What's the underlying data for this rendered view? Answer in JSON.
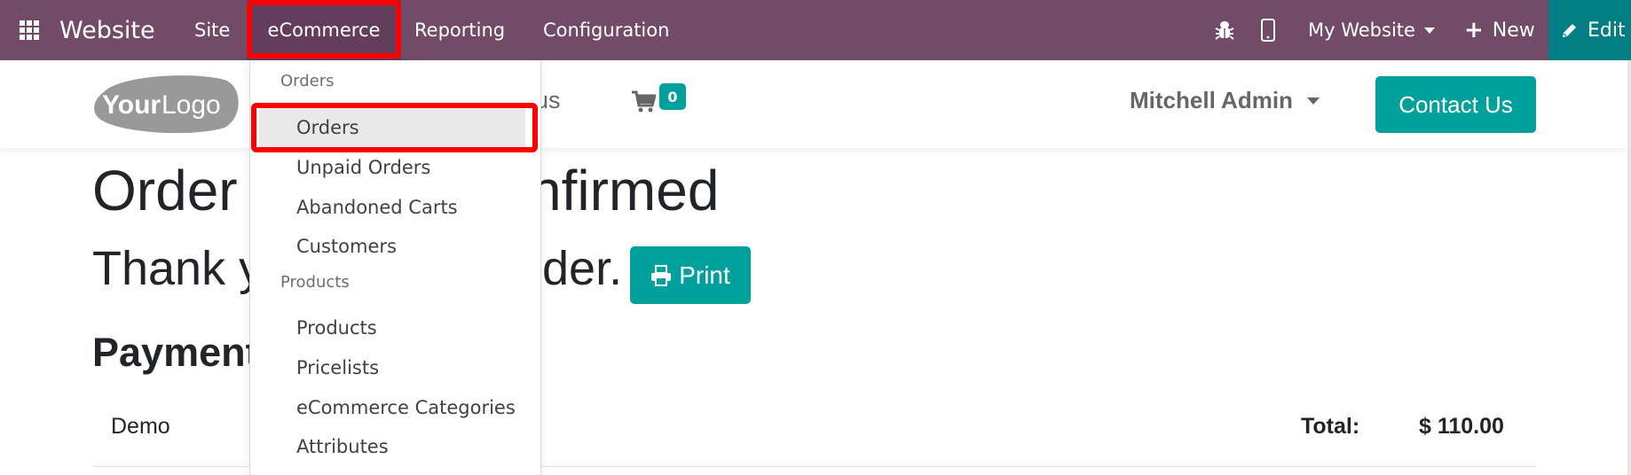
{
  "navbar": {
    "app_icon": "apps-grid-icon",
    "brand": "Website",
    "menus": [
      {
        "label": "Site"
      },
      {
        "label": "eCommerce",
        "highlighted": true
      },
      {
        "label": "Reporting"
      },
      {
        "label": "Configuration"
      }
    ],
    "right": {
      "debug_icon": "bug-icon",
      "mobile_preview_icon": "mobile-icon",
      "website_selector": "My Website",
      "new_label": "New",
      "edit_label": "Edit"
    },
    "colors": {
      "navbar_bg": "#714b67",
      "edit_bg": "#017e84",
      "highlight": "#ff0000"
    }
  },
  "site_header": {
    "logo_text_bold": "Your",
    "logo_text_light": "Logo",
    "visible_menu_fragment": "t us",
    "cart_count": "0",
    "user_name": "Mitchell Admin",
    "contact_button": "Contact Us",
    "accent_color": "#00a09d"
  },
  "dropdown": {
    "sections": [
      {
        "title": "Orders",
        "items": [
          {
            "label": "Orders",
            "active": true
          },
          {
            "label": "Unpaid Orders"
          },
          {
            "label": "Abandoned Carts"
          },
          {
            "label": "Customers"
          }
        ]
      },
      {
        "title": "Products",
        "items": [
          {
            "label": "Products"
          },
          {
            "label": "Pricelists"
          },
          {
            "label": "eCommerce Categories"
          },
          {
            "label": "Attributes"
          }
        ]
      }
    ]
  },
  "main": {
    "heading_left": "Order",
    "heading_right": "nfirmed",
    "thanks_left": "Thank y",
    "thanks_right": "der.",
    "print_label": "Print",
    "payment_heading": "Payment",
    "payment_row": {
      "method": "Demo",
      "total_label": "Total:",
      "total_value": "$ 110.00"
    }
  }
}
